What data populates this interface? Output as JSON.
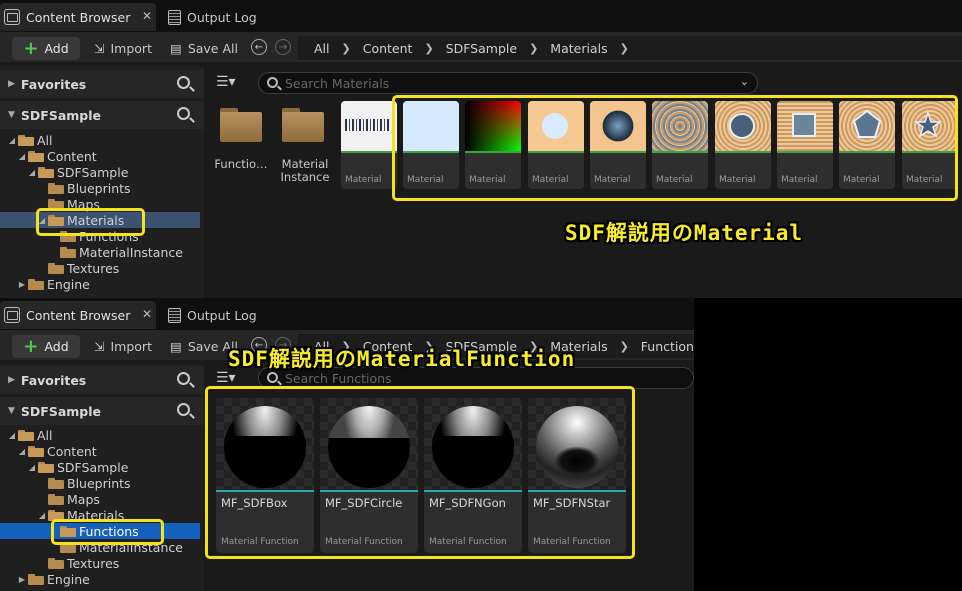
{
  "top": {
    "tabs": [
      {
        "label": "Content Browser",
        "close": "✕"
      },
      {
        "label": "Output Log"
      }
    ],
    "toolbar": {
      "add": "Add",
      "import": "Import",
      "save_all": "Save All"
    },
    "breadcrumb": [
      "All",
      "Content",
      "SDFSample",
      "Materials"
    ],
    "left": {
      "favorites": "Favorites",
      "root": "SDFSample",
      "tree": [
        "All",
        "Content",
        "SDFSample",
        "Blueprints",
        "Maps",
        "Materials",
        "Functions",
        "MaterialInstance",
        "Textures",
        "Engine"
      ]
    },
    "search_placeholder": "Search Materials",
    "folders": [
      {
        "name": "Functio…"
      },
      {
        "name": "Material Instance"
      }
    ],
    "tiles_type": "Material",
    "annotation": "SDF解説用のMaterial"
  },
  "bottom": {
    "tabs": [
      {
        "label": "Content Browser",
        "close": "✕"
      },
      {
        "label": "Output Log"
      }
    ],
    "toolbar": {
      "add": "Add",
      "import": "Import",
      "save_all": "Save All"
    },
    "breadcrumb": [
      "All",
      "Content",
      "SDFSample",
      "Materials",
      "Functions"
    ],
    "left": {
      "favorites": "Favorites",
      "root": "SDFSample",
      "tree": [
        "All",
        "Content",
        "SDFSample",
        "Blueprints",
        "Maps",
        "Materials",
        "Functions",
        "MaterialInstance",
        "Textures",
        "Engine"
      ]
    },
    "search_placeholder": "Search Functions",
    "functions": [
      {
        "name": "MF_SDFBox",
        "type": "Material Function"
      },
      {
        "name": "MF_SDFCircle",
        "type": "Material Function"
      },
      {
        "name": "MF_SDFNGon",
        "type": "Material Function"
      },
      {
        "name": "MF_SDFNStar",
        "type": "Material Function"
      }
    ],
    "annotation": "SDF解説用のMaterialFunction"
  },
  "colors": {
    "highlight": "#f4e21a",
    "material_line": "#3da53d",
    "function_line": "#2aa7b0",
    "selection": "#1560bd"
  }
}
